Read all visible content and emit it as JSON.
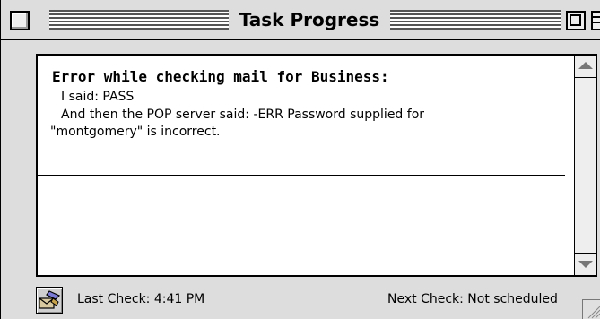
{
  "window": {
    "title": "Task Progress"
  },
  "message": {
    "title": "Error while checking mail for Business:",
    "lines": [
      "I said: PASS",
      "And then the POP server said: -ERR Password supplied for",
      "\"montgomery\" is incorrect."
    ]
  },
  "status": {
    "last_check": "Last Check: 4:41 PM",
    "next_check": "Next Check: Not scheduled"
  },
  "icons": {
    "mail_button": "check-mail-icon",
    "close": "close-box-icon",
    "zoom": "zoom-box-icon",
    "collapse": "collapse-box-icon",
    "grow": "grow-box-icon"
  }
}
